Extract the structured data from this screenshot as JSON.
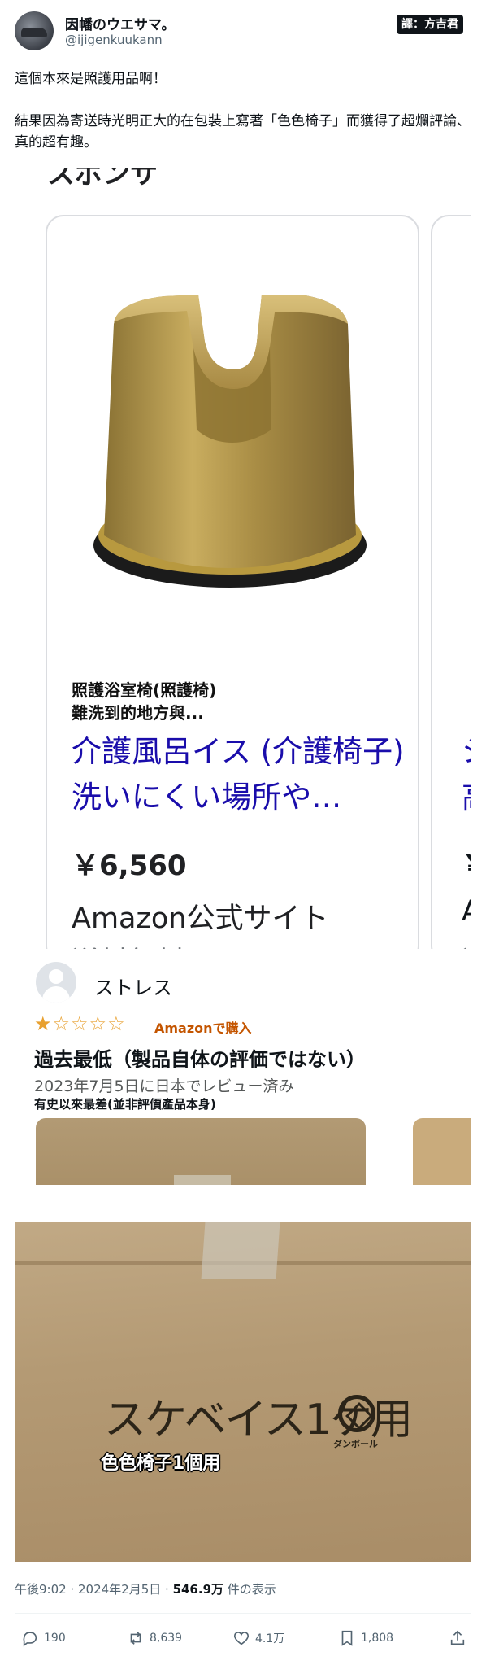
{
  "author": {
    "display_name": "因幡のウエサマ。",
    "handle": "@ijigenkuukann",
    "watermark": "譯：方吉君"
  },
  "tweet": {
    "text": "這個本來是照護用品啊！\n\n結果因為寄送時光明正大的在包裝上寫著「色色椅子」而獲得了超爛評論、真的超有趣。"
  },
  "shopping": {
    "cut_heading": "スポンサ",
    "overlay_translation": "照護浴室椅(照護椅)\n難洗到的地方與...",
    "product_title": "介護風呂イス (介護椅子) 洗いにくい場所や…",
    "price": "￥6,560",
    "seller": "Amazon公式サイト",
    "shipping": "送料無料",
    "next_card": {
      "title": "シ\n高",
      "price": "￥",
      "seller": "A",
      "shipping": "送"
    }
  },
  "review": {
    "reviewer": "ストレス",
    "rating": 1,
    "rating_max": 5,
    "stars_text": "★☆☆☆☆",
    "verified": "Amazonで購入",
    "title": "過去最低（製品自体の評価ではない）",
    "date": "2023年7月5日に日本でレビュー済み",
    "translation": "有史以來最差(並非評價產品本身)"
  },
  "box_photo": {
    "printed_label": "スケベイス1ケ用",
    "translation": "色色椅子1個用",
    "mark_text": "ダンボール"
  },
  "meta": {
    "time": "午後9:02 · 2024年2月5日 · ",
    "views": "546.9万",
    "views_suffix": " 件の表示"
  },
  "actions": {
    "replies": "190",
    "reposts": "8,639",
    "likes": "4.1万",
    "bookmarks": "1,808"
  },
  "colors": {
    "link_blue": "#1a0dab",
    "star_orange": "#e8a02f",
    "verified_orange": "#c45500",
    "secondary_text": "#536471"
  }
}
